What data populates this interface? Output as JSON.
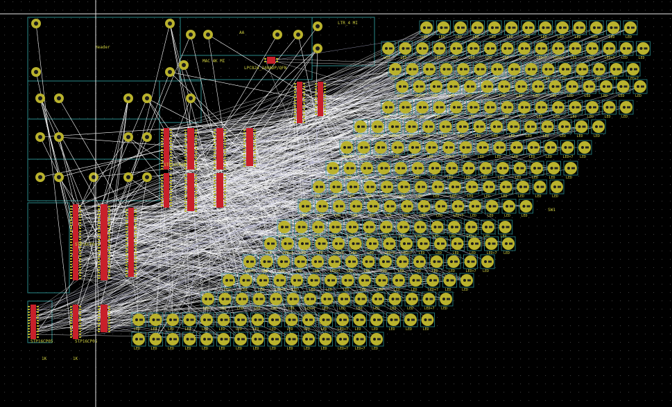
{
  "app": {
    "view": "pcb-layout-editor"
  },
  "colors": {
    "background": "#000000",
    "grid_dot": "#3a3a3a",
    "board_outline": "#2a8a8a",
    "pad": "#b9b22d",
    "pad_hole": "#1a1a1a",
    "pad_outline": "#2c8c8c",
    "ratsnest": "#ffffff",
    "ratsnest_dim": "#b8b8d8",
    "smd_red": "#c8202a",
    "silk_text": "#cfcf40",
    "crosshair": "#e8e8e8"
  },
  "labels": {
    "power_connector": "Header",
    "ac_block_a": "AA",
    "ac_block_b": "MAC 4K MI",
    "module_ref": "LTR_4 MI",
    "mcu_ref": "LPC824_240ADP/QFN",
    "ic_sip_1": "STP16CP05",
    "ic_sip_2": "STP16CP05",
    "ic_sip_3": "STP16CP05",
    "ic_sip_4": "STP16CP05",
    "resistor_1": "1K",
    "resistor_2": "1K",
    "resistor_3": "R1",
    "resistor_4": "R2",
    "led_label": "LED",
    "led_rgb_label": "LED+7",
    "bottom_left_ic": "STP16CP05",
    "bottom_left_ic_2": "STP16CP05",
    "switch_label": "SW1"
  }
}
